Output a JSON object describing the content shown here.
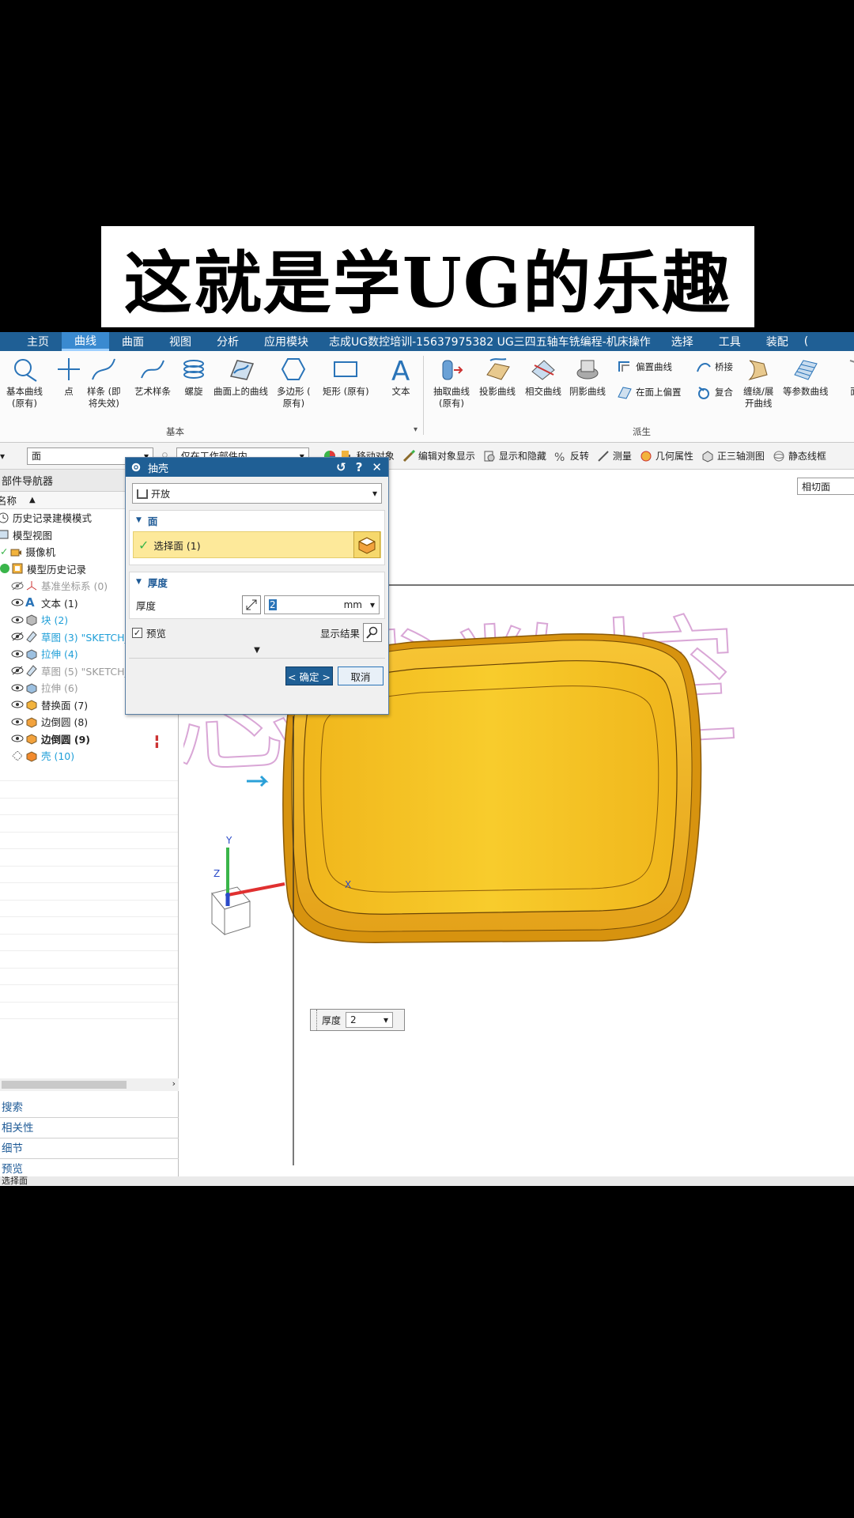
{
  "banner": {
    "title": "这就是学UG的乐趣"
  },
  "menu": {
    "items": [
      "主页",
      "曲线",
      "曲面",
      "视图",
      "分析",
      "应用模块",
      "志成UG数控培训-15637975382  UG三四五轴车铣编程-机床操作",
      "选择",
      "工具",
      "装配",
      "("
    ],
    "active_index": 1
  },
  "ribbon": {
    "basic": [
      {
        "label": "基本曲线",
        "sub": "(原有)",
        "icon": "basic-curve-icon"
      },
      {
        "label": "点",
        "sub": "",
        "icon": "point-icon"
      },
      {
        "label": "样条 (即",
        "sub": "将失效)",
        "icon": "spline-icon"
      },
      {
        "label": "艺术样条",
        "sub": "",
        "icon": "studio-spline-icon"
      },
      {
        "label": "螺旋",
        "sub": "",
        "icon": "helix-icon"
      },
      {
        "label": "曲面上的曲线",
        "sub": "",
        "icon": "curve-on-surface-icon"
      },
      {
        "label": "多边形 (",
        "sub": "原有)",
        "icon": "polygon-icon"
      },
      {
        "label": "矩形 (原有)",
        "sub": "",
        "icon": "rectangle-icon"
      },
      {
        "label": "文本",
        "sub": "",
        "icon": "text-icon"
      }
    ],
    "basic_group": "基本",
    "derived": [
      {
        "label": "抽取曲线",
        "sub": "(原有)",
        "icon": "extract-curve-icon"
      },
      {
        "label": "投影曲线",
        "sub": "",
        "icon": "project-curve-icon"
      },
      {
        "label": "相交曲线",
        "sub": "",
        "icon": "intersect-curve-icon"
      },
      {
        "label": "阴影曲线",
        "sub": "",
        "icon": "shadow-curve-icon"
      }
    ],
    "derived_small": [
      "偏置曲线",
      "在面上偏置",
      "桥接",
      "复合"
    ],
    "derived_more": [
      {
        "label": "缠绕/展",
        "sub": "开曲线",
        "icon": "wrap-curve-icon"
      },
      {
        "label": "等参数曲线",
        "sub": "",
        "icon": "iso-curve-icon"
      },
      {
        "label": "面",
        "sub": "",
        "icon": "face-curve-icon"
      }
    ],
    "derived_group": "派生"
  },
  "toolbar": {
    "left_combo": "▾",
    "filter_combo": "面",
    "scope_combo": "仅在工作部件内",
    "buttons": [
      "移动对象",
      "编辑对象显示",
      "显示和隐藏",
      "反转",
      "测量",
      "几何属性",
      "正三轴测图",
      "静态线框"
    ]
  },
  "navigator": {
    "title": "部件导航器",
    "column": "名称",
    "rows": [
      {
        "text": "历史记录建模模式",
        "indent": 0,
        "style": "",
        "icon": "clock-icon"
      },
      {
        "text": "模型视图",
        "indent": 0,
        "style": "",
        "icon": "model-view-icon"
      },
      {
        "text": "摄像机",
        "indent": 0,
        "style": "",
        "icon": "camera-icon"
      },
      {
        "text": "模型历史记录",
        "indent": 0,
        "style": "",
        "icon": "model-history-icon"
      },
      {
        "text": "基准坐标系 (0)",
        "indent": 1,
        "style": "dim",
        "icon": "datum-csys-icon"
      },
      {
        "text": "文本 (1)",
        "indent": 1,
        "style": "",
        "icon": "text-feature-icon"
      },
      {
        "text": "块 (2)",
        "indent": 1,
        "style": "blue",
        "icon": "block-icon"
      },
      {
        "text": "草图 (3) \"SKETCH_",
        "indent": 1,
        "style": "blue",
        "icon": "sketch-icon"
      },
      {
        "text": "拉伸 (4)",
        "indent": 1,
        "style": "blue",
        "icon": "extrude-icon"
      },
      {
        "text": "草图 (5) \"SKETCH_",
        "indent": 1,
        "style": "dim",
        "icon": "sketch-icon"
      },
      {
        "text": "拉伸 (6)",
        "indent": 1,
        "style": "dim",
        "icon": "extrude-icon"
      },
      {
        "text": "替换面 (7)",
        "indent": 1,
        "style": "",
        "icon": "replace-face-icon"
      },
      {
        "text": "边倒圆 (8)",
        "indent": 1,
        "style": "",
        "icon": "edge-blend-icon"
      },
      {
        "text": "边倒圆 (9)",
        "indent": 1,
        "style": "bold",
        "icon": "edge-blend-icon"
      },
      {
        "text": "壳 (10)",
        "indent": 1,
        "style": "blue",
        "icon": "shell-icon"
      }
    ],
    "panels": [
      "搜索",
      "相关性",
      "细节",
      "预览"
    ]
  },
  "viewport": {
    "section_combo": "相切面",
    "watermark": "志成数控",
    "axis_x": "X",
    "axis_y": "Y",
    "axis_z": "Z",
    "thickness_label": "厚度",
    "thickness_value": "2"
  },
  "dialog": {
    "title": "抽壳",
    "type": "开放",
    "face_section": "面",
    "select_label": "选择面 (1)",
    "thickness_section": "厚度",
    "thickness_label": "厚度",
    "thickness_value": "2",
    "unit": "mm",
    "preview_label": "预览",
    "show_result": "显示结果",
    "ok": "< 确定 >",
    "cancel": "取消"
  },
  "status": "选择面"
}
